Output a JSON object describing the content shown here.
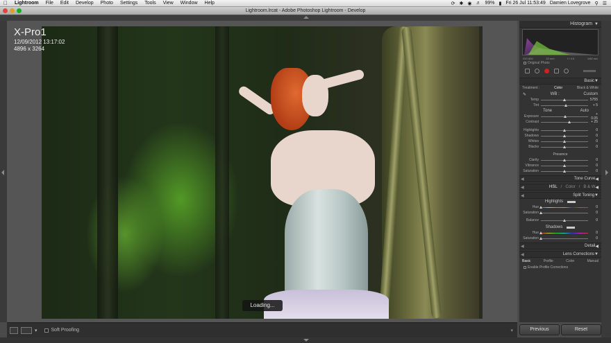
{
  "menubar": {
    "items": [
      "Lightroom",
      "File",
      "Edit",
      "Develop",
      "Photo",
      "Settings",
      "Tools",
      "View",
      "Window",
      "Help"
    ],
    "battery": "99%",
    "clock": "Fri 26 Jul  11:53:49",
    "user": "Damien Lovegrove"
  },
  "window": {
    "title": "Lightroom.lrcat - Adobe Photoshop Lightroom - Develop"
  },
  "info_overlay": {
    "camera": "X-Pro1",
    "datetime": "12/09/2012 13:17:02",
    "dimensions": "4896 x 3264"
  },
  "loading": "Loading...",
  "toolbar": {
    "soft_proofing": "Soft Proofing"
  },
  "panels": {
    "histogram": {
      "title": "Histogram",
      "meta": [
        "ISO 800",
        "23 mm",
        "f / 4.0",
        "1/60 sec"
      ],
      "original_photo": "Original Photo"
    },
    "basic": {
      "title": "Basic",
      "treatment_label": "Treatment :",
      "treatment_color": "Color",
      "treatment_bw": "Black & White",
      "wb_label": "WB :",
      "wb_value": "Custom",
      "temp": {
        "label": "Temp",
        "value": "5755",
        "pos": 0.5
      },
      "tint": {
        "label": "Tint",
        "value": "+ 5",
        "pos": 0.53
      },
      "tone_label": "Tone",
      "auto": "Auto",
      "exposure": {
        "label": "Exposure",
        "value": "+ 0.05",
        "pos": 0.51
      },
      "contrast": {
        "label": "Contrast",
        "value": "+ 25",
        "pos": 0.6
      },
      "highlights": {
        "label": "Highlights",
        "value": "0",
        "pos": 0.5
      },
      "shadows": {
        "label": "Shadows",
        "value": "0",
        "pos": 0.5
      },
      "whites": {
        "label": "Whites",
        "value": "0",
        "pos": 0.5
      },
      "blacks": {
        "label": "Blacks",
        "value": "0",
        "pos": 0.5
      },
      "presence_label": "Presence",
      "clarity": {
        "label": "Clarity",
        "value": "0",
        "pos": 0.5
      },
      "vibrance": {
        "label": "Vibrance",
        "value": "0",
        "pos": 0.5
      },
      "saturation": {
        "label": "Saturation",
        "value": "0",
        "pos": 0.5
      }
    },
    "tone_curve": {
      "title": "Tone Curve"
    },
    "hsl": {
      "hsl": "HSL",
      "color": "Color",
      "bw": "B & W"
    },
    "split_toning": {
      "title": "Split Toning",
      "highlights_label": "Highlights",
      "hue": {
        "label": "Hue",
        "value": "0",
        "pos": 0.0
      },
      "saturation": {
        "label": "Saturation",
        "value": "0",
        "pos": 0.0
      },
      "balance": {
        "label": "Balance",
        "value": "0",
        "pos": 0.5
      },
      "shadows_label": "Shadows",
      "s_hue": {
        "label": "Hue",
        "value": "0",
        "pos": 0.0
      },
      "s_saturation": {
        "label": "Saturation",
        "value": "0",
        "pos": 0.0
      }
    },
    "detail": {
      "title": "Detail"
    },
    "lens": {
      "title": "Lens Corrections",
      "tabs": [
        "Basic",
        "Profile",
        "Color",
        "Manual"
      ],
      "enable_profile": "Enable Profile Corrections"
    }
  },
  "buttons": {
    "previous": "Previous",
    "reset": "Reset"
  }
}
